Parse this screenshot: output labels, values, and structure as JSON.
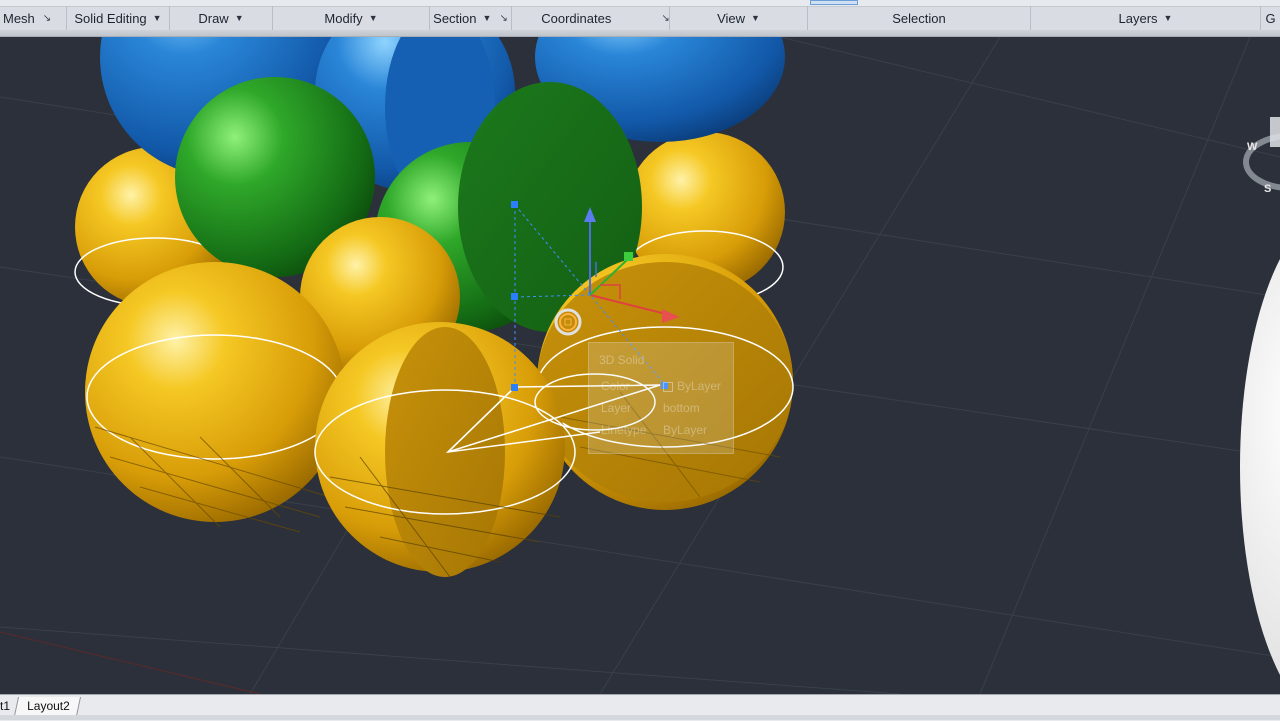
{
  "ribbon": {
    "panels": [
      {
        "label": "Mesh",
        "has_dropdown": false,
        "has_launcher": true
      },
      {
        "label": "Solid Editing",
        "has_dropdown": true,
        "has_launcher": false
      },
      {
        "label": "Draw",
        "has_dropdown": true,
        "has_launcher": false
      },
      {
        "label": "Modify",
        "has_dropdown": true,
        "has_launcher": false
      },
      {
        "label": "Section",
        "has_dropdown": true,
        "has_launcher": true
      },
      {
        "label": "Coordinates",
        "has_dropdown": false,
        "has_launcher": true
      },
      {
        "label": "View",
        "has_dropdown": true,
        "has_launcher": false
      },
      {
        "label": "Selection",
        "has_dropdown": false,
        "has_launcher": false
      },
      {
        "label": "Layers",
        "has_dropdown": true,
        "has_launcher": false
      },
      {
        "label": "G",
        "has_dropdown": false,
        "has_launcher": false
      }
    ],
    "caret_icon": "chevron-down-icon",
    "launcher_icon": "dialog-launcher-icon"
  },
  "viewport": {
    "background": "#2b303a",
    "colors": {
      "yellow_sphere": "#e8b40e",
      "green_sphere": "#1f8a1f",
      "blue_sphere": "#1a6fc4",
      "selection_outline": "#ffffff",
      "gizmo_x": "#e04040",
      "gizmo_y": "#30b030",
      "gizmo_z": "#4a6fe0"
    },
    "viewcube_letters": {
      "west": "W",
      "south": "S"
    }
  },
  "quick_properties": {
    "title": "3D Solid",
    "rows": [
      {
        "key": "Color",
        "value": "ByLayer"
      },
      {
        "key": "Layer",
        "value": "bottom"
      },
      {
        "key": "Linetype",
        "value": "ByLayer"
      }
    ]
  },
  "layout_tabs": {
    "partial_tab": "t1",
    "active_tab": "Layout2"
  }
}
